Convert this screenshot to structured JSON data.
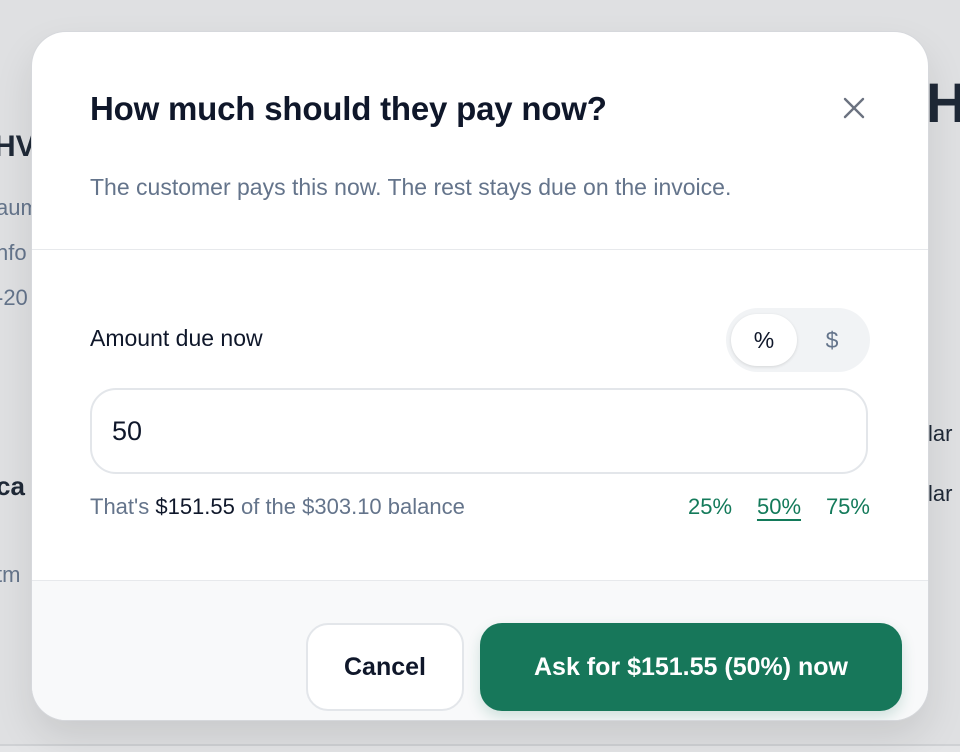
{
  "background": {
    "left_fragments": [
      "HV",
      "aum",
      "nfo",
      "-20",
      "ca",
      "tm"
    ],
    "right_fragments": [
      "H",
      "lar",
      "lar"
    ]
  },
  "modal": {
    "title": "How much should they pay now?",
    "subtitle": "The customer pays this now. The rest stays due on the invoice.",
    "close_icon": "close-icon",
    "field_label": "Amount due now",
    "unit_toggle": {
      "options": [
        "%",
        "$"
      ],
      "selected": "%"
    },
    "amount_input": {
      "value": "50"
    },
    "summary": {
      "prefix": "That's ",
      "amount": "$151.55",
      "suffix": " of the $303.10 balance"
    },
    "presets": [
      "25%",
      "50%",
      "75%"
    ],
    "selected_preset": "50%",
    "cancel_label": "Cancel",
    "confirm_label": "Ask for $151.55 (50%) now"
  },
  "colors": {
    "accent": "#17775a",
    "preset_link": "#137a5a",
    "title": "#0f172a",
    "muted": "#64748b"
  }
}
